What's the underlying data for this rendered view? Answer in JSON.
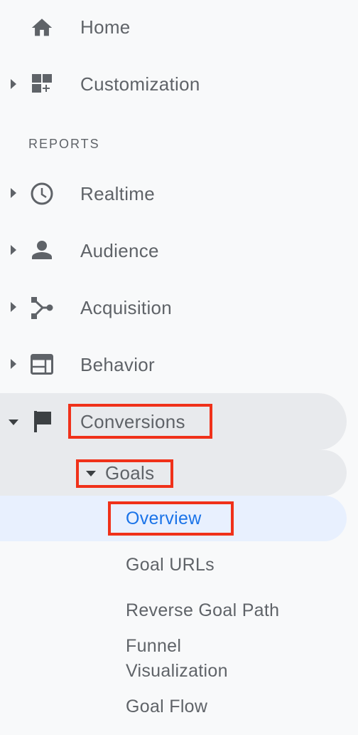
{
  "nav": {
    "home": "Home",
    "customization": "Customization",
    "section_header": "REPORTS",
    "realtime": "Realtime",
    "audience": "Audience",
    "acquisition": "Acquisition",
    "behavior": "Behavior",
    "conversions": "Conversions",
    "goals": "Goals",
    "goal_items": [
      "Overview",
      "Goal URLs",
      "Reverse Goal Path",
      "Funnel Visualization",
      "Goal Flow"
    ]
  },
  "funnel_lines": [
    "Funnel",
    "Visualization"
  ],
  "colors": {
    "background": "#f8f9fa",
    "text": "#5f6368",
    "active_text": "#1a73e8",
    "active_bg": "#e8f0fe",
    "expanded_bg": "#e8eaed",
    "highlight": "#f0311a"
  },
  "icons": [
    "home-icon",
    "dashboard-add-icon",
    "clock-icon",
    "person-icon",
    "acquisition-icon",
    "behavior-icon",
    "flag-icon"
  ]
}
